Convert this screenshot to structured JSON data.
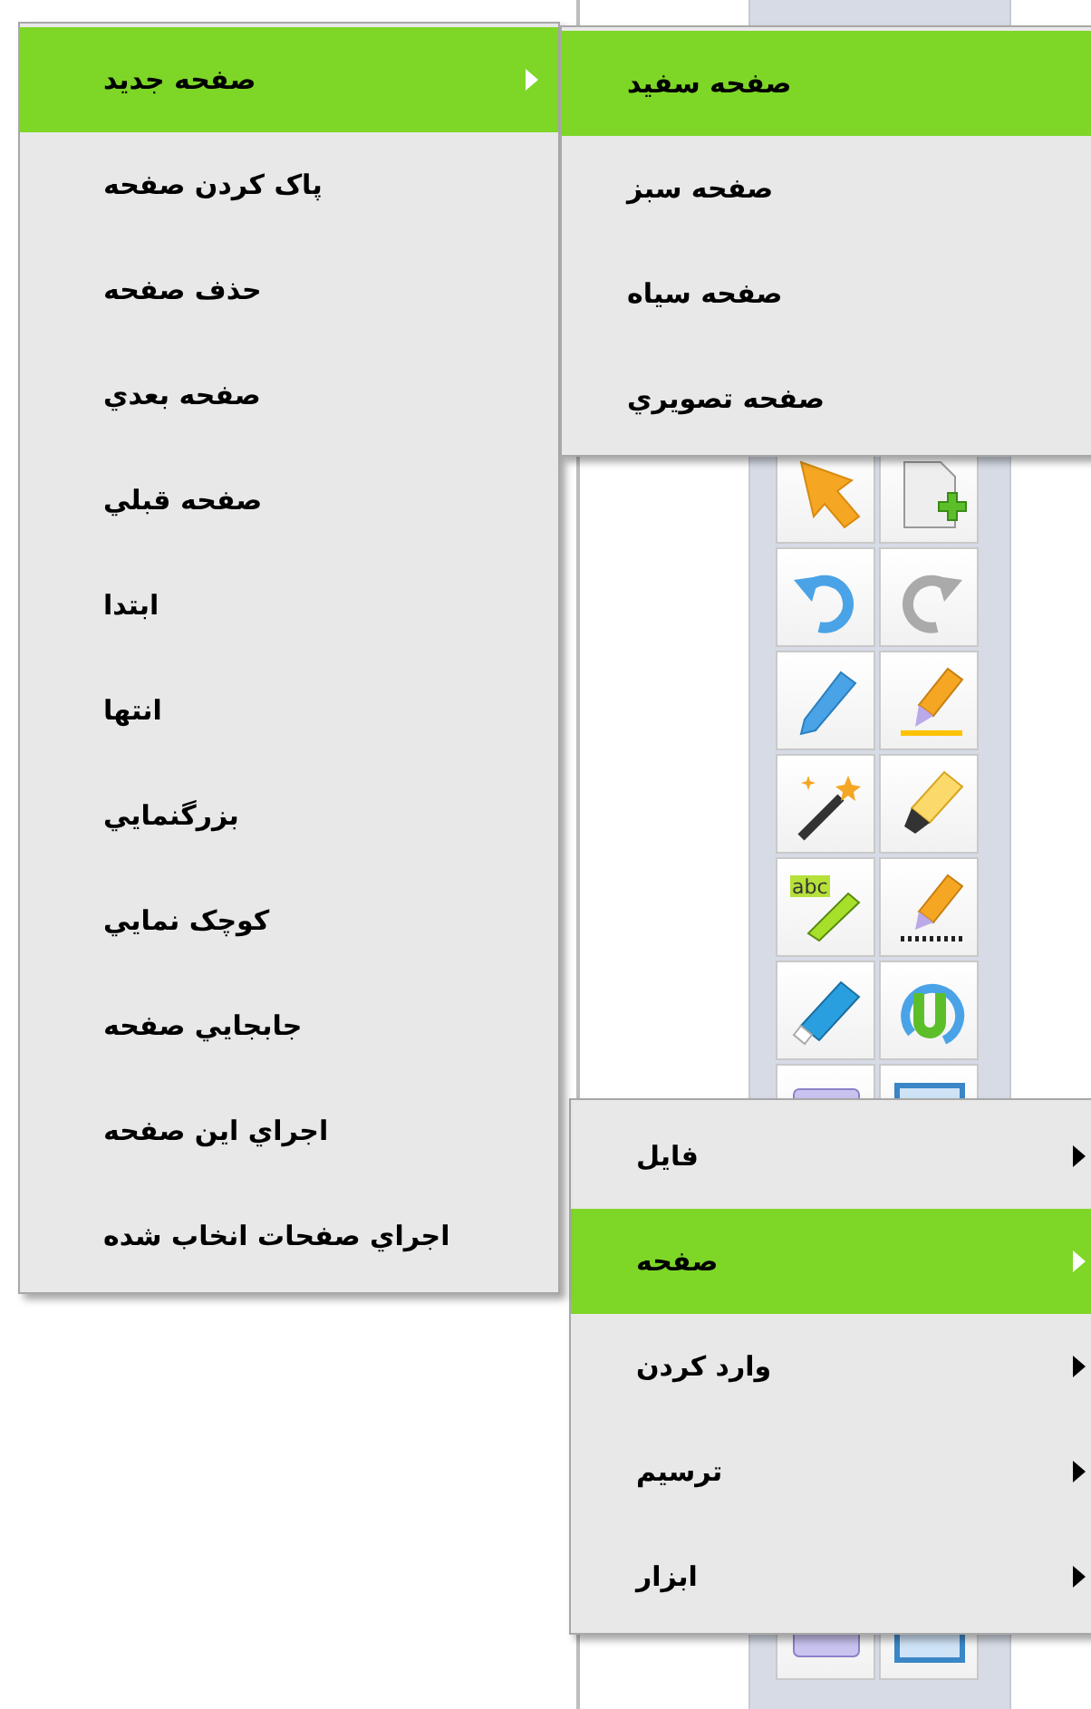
{
  "toolbar": {
    "text_tool_label": "abc"
  },
  "context_menu": {
    "items": [
      {
        "label": "صفحه جديد",
        "selected": true,
        "has_submenu": true
      },
      {
        "label": "پاک کردن صفحه",
        "selected": false,
        "has_submenu": false
      },
      {
        "label": "حذف صفحه",
        "selected": false,
        "has_submenu": false
      },
      {
        "label": "صفحه بعدي",
        "selected": false,
        "has_submenu": false
      },
      {
        "label": "صفحه قبلي",
        "selected": false,
        "has_submenu": false
      },
      {
        "label": "ابتدا",
        "selected": false,
        "has_submenu": false
      },
      {
        "label": "انتها",
        "selected": false,
        "has_submenu": false
      },
      {
        "label": "بزرگنمايي",
        "selected": false,
        "has_submenu": false
      },
      {
        "label": "کوچک نمايي",
        "selected": false,
        "has_submenu": false
      },
      {
        "label": "جابجايي صفحه",
        "selected": false,
        "has_submenu": false
      },
      {
        "label": "اجراي اين صفحه",
        "selected": false,
        "has_submenu": false
      },
      {
        "label": "اجراي صفحات انخاب شده",
        "selected": false,
        "has_submenu": false
      }
    ]
  },
  "new_page_submenu": {
    "items": [
      {
        "label": "صفحه سفيد",
        "selected": true
      },
      {
        "label": "صفحه سبز",
        "selected": false
      },
      {
        "label": "صفحه سياه",
        "selected": false
      },
      {
        "label": "صفحه تصويري",
        "selected": false
      }
    ]
  },
  "main_menu": {
    "items": [
      {
        "label": "فايل",
        "selected": false,
        "has_submenu": true
      },
      {
        "label": "صفحه",
        "selected": true,
        "has_submenu": true
      },
      {
        "label": "وارد کردن",
        "selected": false,
        "has_submenu": true
      },
      {
        "label": "ترسيم",
        "selected": false,
        "has_submenu": true
      },
      {
        "label": "ابزار",
        "selected": false,
        "has_submenu": true
      }
    ]
  }
}
